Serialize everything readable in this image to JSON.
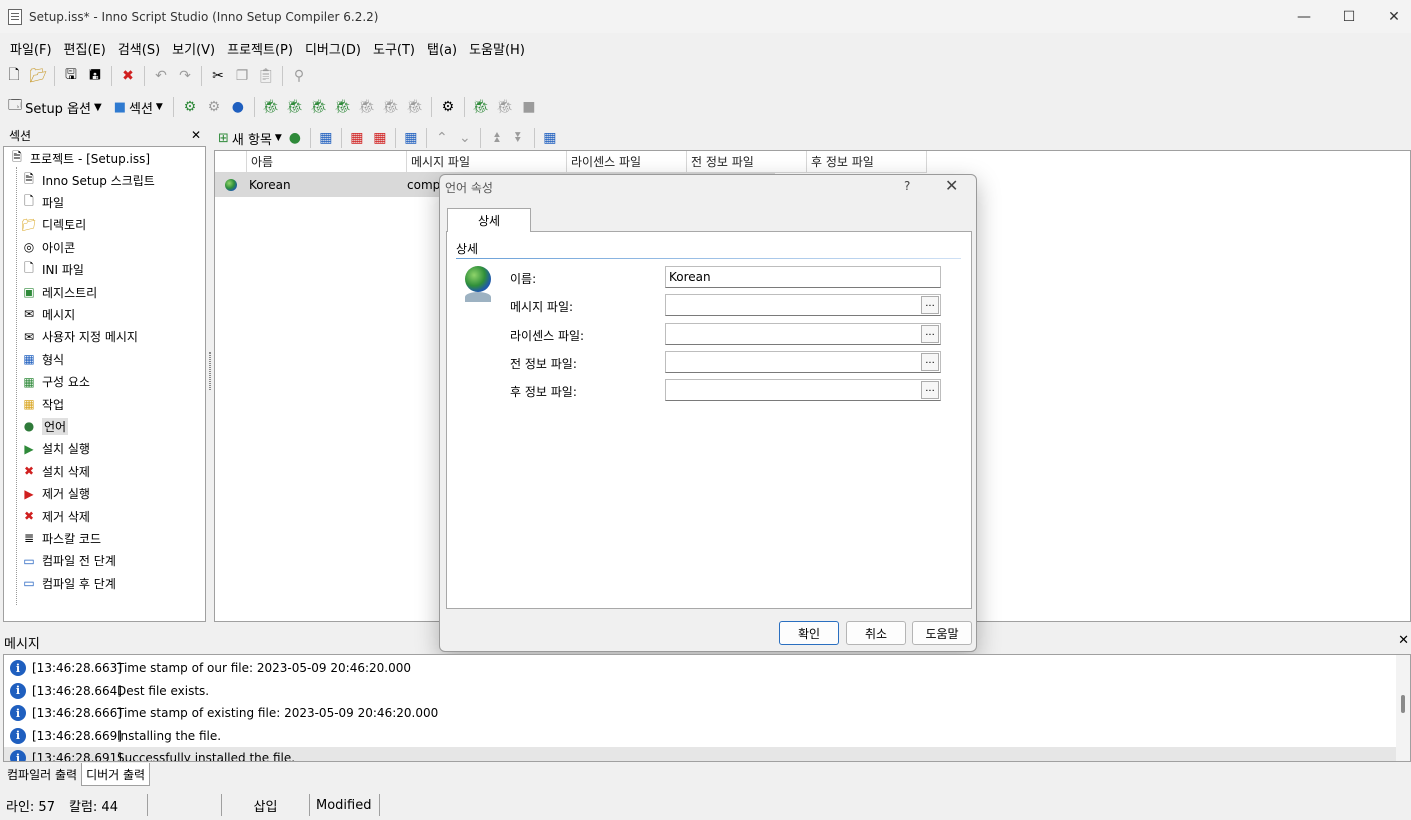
{
  "window": {
    "title": "Setup.iss* - Inno Script Studio (Inno Setup Compiler 6.2.2)"
  },
  "menu": [
    "파일(F)",
    "편집(E)",
    "검색(S)",
    "보기(V)",
    "프로젝트(P)",
    "디버그(D)",
    "도구(T)",
    "탭(a)",
    "도움말(H)"
  ],
  "toolbar2": {
    "setup_options": "Setup 옵션",
    "sections": "섹션"
  },
  "sections_panel": {
    "title": "섹션",
    "root": "프로젝트 - [Setup.iss]",
    "items": [
      {
        "label": "Inno Setup 스크립트",
        "icon": "script-icon"
      },
      {
        "label": "파일",
        "icon": "file-icon"
      },
      {
        "label": "디렉토리",
        "icon": "folder-icon"
      },
      {
        "label": "아이콘",
        "icon": "shortcut-icon"
      },
      {
        "label": "INI 파일",
        "icon": "ini-file-icon"
      },
      {
        "label": "레지스트리",
        "icon": "registry-icon"
      },
      {
        "label": "메시지",
        "icon": "message-icon"
      },
      {
        "label": "사용자 지정 메시지",
        "icon": "custom-message-icon"
      },
      {
        "label": "형식",
        "icon": "types-icon"
      },
      {
        "label": "구성 요소",
        "icon": "components-icon"
      },
      {
        "label": "작업",
        "icon": "tasks-icon"
      },
      {
        "label": "언어",
        "icon": "globe-icon"
      },
      {
        "label": "설치 실행",
        "icon": "run-icon"
      },
      {
        "label": "설치 삭제",
        "icon": "install-delete-icon"
      },
      {
        "label": "제거 실행",
        "icon": "uninstall-run-icon"
      },
      {
        "label": "제거 삭제",
        "icon": "uninstall-delete-icon"
      },
      {
        "label": "파스칼 코드",
        "icon": "code-icon"
      },
      {
        "label": "컴파일 전 단계",
        "icon": "pre-compile-icon"
      },
      {
        "label": "컴파일 후 단계",
        "icon": "post-compile-icon"
      }
    ],
    "selected": "언어"
  },
  "languages_toolbar": {
    "new_item": "새 항목"
  },
  "languages_grid": {
    "columns": [
      "아름",
      "메시지 파일",
      "라이센스 파일",
      "전 정보 파일",
      "후 정보 파일"
    ],
    "rows": [
      {
        "name": "Korean",
        "messages_file": "comp"
      }
    ]
  },
  "dialog": {
    "title": "언어 속성",
    "help_glyph": "?",
    "tab": "상세",
    "group": "상세",
    "fields": [
      {
        "label": "이름:",
        "value": "Korean",
        "has_browse": false
      },
      {
        "label": "메시지 파일:",
        "value": "",
        "has_browse": true
      },
      {
        "label": "라이센스 파일:",
        "value": "",
        "has_browse": true
      },
      {
        "label": "전 정보 파일:",
        "value": "",
        "has_browse": true
      },
      {
        "label": "후 정보 파일:",
        "value": "",
        "has_browse": true
      }
    ],
    "browse_label": "...",
    "buttons": {
      "ok": "확인",
      "cancel": "취소",
      "help": "도움말"
    }
  },
  "messages_panel": {
    "title": "메시지",
    "rows": [
      {
        "time": "[13:46:28.663]",
        "text": "Time stamp of our file: 2023-05-09 20:46:20.000"
      },
      {
        "time": "[13:46:28.664]",
        "text": "Dest file exists."
      },
      {
        "time": "[13:46:28.666]",
        "text": "Time stamp of existing file: 2023-05-09 20:46:20.000"
      },
      {
        "time": "[13:46:28.669]",
        "text": "Installing the file."
      },
      {
        "time": "[13:46:28.691]",
        "text": "Successfully installed the file."
      }
    ]
  },
  "bottom_tabs": [
    "컴파일러 출력",
    "디버거 출력"
  ],
  "status": {
    "line": "라인: 57",
    "column": "칼럼: 44",
    "mode": "삽입",
    "state": "Modified"
  }
}
